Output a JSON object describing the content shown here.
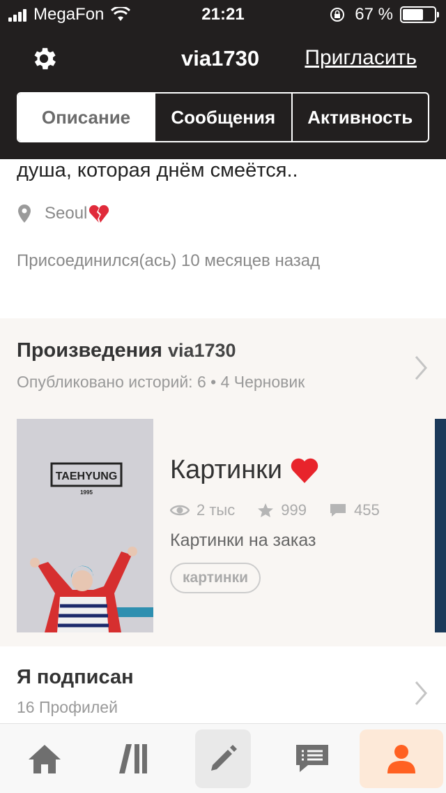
{
  "status_bar": {
    "carrier": "MegaFon",
    "time": "21:21",
    "battery_percent": "67 %",
    "battery_level": 0.67
  },
  "header": {
    "username": "via1730",
    "invite_label": "Пригласить",
    "tabs": [
      {
        "label": "Описание",
        "active": true
      },
      {
        "label": "Сообщения",
        "active": false
      },
      {
        "label": "Активность",
        "active": false
      }
    ]
  },
  "profile": {
    "bio_tail": "душа, которая днём смеётся..",
    "location": "Seoul",
    "joined": "Присоединился(ась) 10 месяцев назад"
  },
  "works": {
    "title": "Произведения",
    "username": "via1730",
    "subtitle": "Опубликовано историй: 6 • 4 Черновик",
    "cover_text": "TAEHYUNG",
    "cover_year": "1995",
    "story": {
      "title": "Картинки",
      "reads": "2 тыс",
      "votes": "999",
      "comments": "455",
      "description": "Картинки на заказ",
      "tag": "картинки"
    }
  },
  "following": {
    "title": "Я подписан",
    "subtitle": "16 Профилей"
  },
  "tabbar": {
    "items": [
      "home-tab",
      "library-tab",
      "write-tab",
      "messages-tab",
      "profile-tab"
    ],
    "active": "profile-tab",
    "accent_color": "#ff6122"
  }
}
